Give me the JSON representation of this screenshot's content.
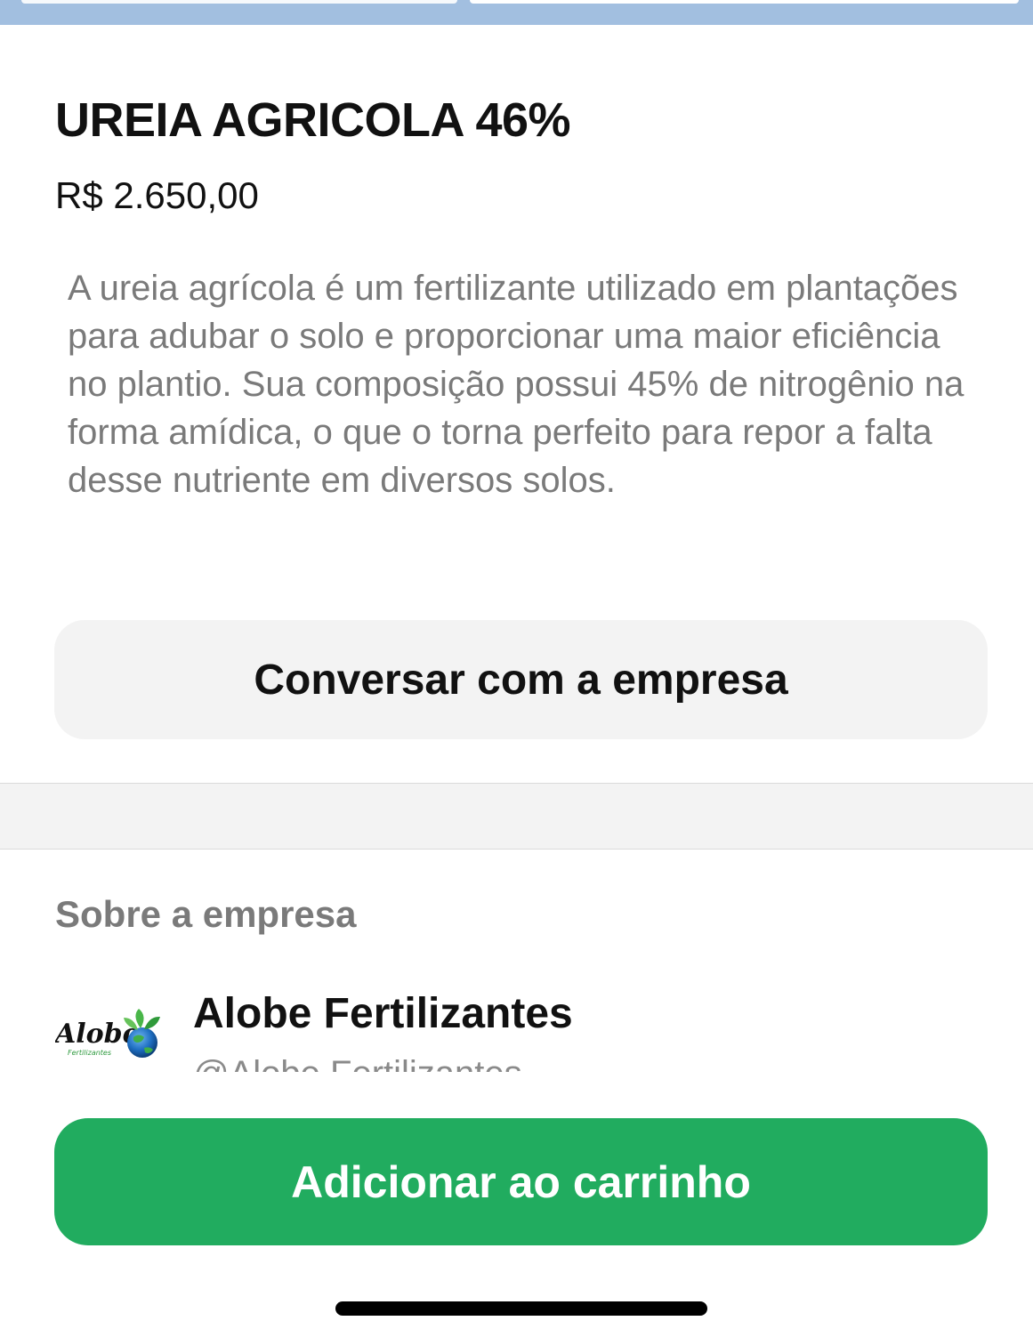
{
  "product": {
    "title": "UREIA AGRICOLA 46%",
    "price": "R$ 2.650,00",
    "description": "A ureia agrícola é um fertilizante utilizado em plantações para adubar o solo e proporcionar uma maior eficiência no plantio. Sua composição possui 45% de nitrogênio na forma amídica, o que o torna perfeito para repor a falta desse nutriente em diversos solos."
  },
  "actions": {
    "chat_label": "Conversar com a empresa",
    "add_to_cart_label": "Adicionar ao carrinho"
  },
  "about": {
    "section_title": "Sobre a empresa",
    "company_name": "Alobe Fertilizantes",
    "company_handle": "@Alobe Fertilizantes",
    "logo_text": "Alobe",
    "logo_subtext": "Fertilizantes"
  },
  "colors": {
    "accent_green": "#21ac5f",
    "top_strip": "#a2bfe0",
    "button_gray": "#f3f3f3",
    "secondary_text": "#7a7a7a"
  }
}
